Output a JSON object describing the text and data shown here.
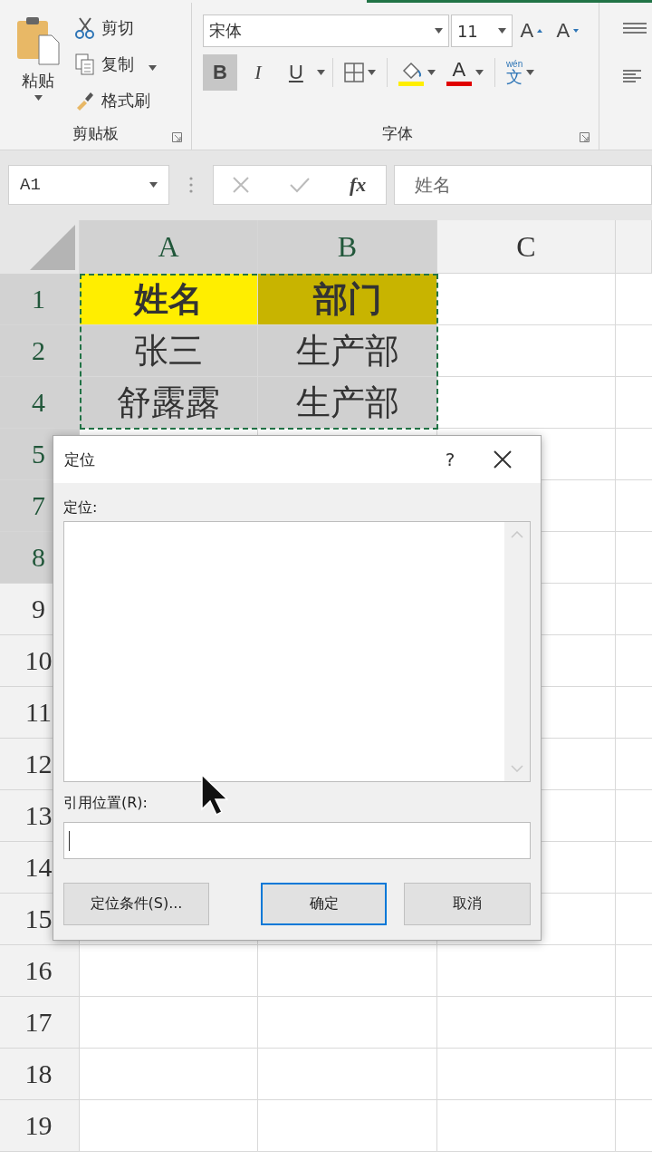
{
  "ribbon": {
    "clipboard": {
      "paste": "粘贴",
      "cut": "剪切",
      "copy": "复制",
      "format_painter": "格式刷",
      "label": "剪贴板"
    },
    "font": {
      "font_name": "宋体",
      "font_size": "11",
      "grow": "A",
      "shrink": "A",
      "bold": {
        "label": "B",
        "on": true
      },
      "italic": {
        "label": "I",
        "on": false
      },
      "underline": {
        "label": "U",
        "on": false
      },
      "font_color": "A",
      "phonetic": {
        "ruby": "wén",
        "glyph": "文"
      },
      "label": "字体"
    }
  },
  "formula_bar": {
    "name_box": "A1",
    "fx": "fx",
    "content": "姓名"
  },
  "sheet": {
    "columns": [
      {
        "label": "A",
        "selected": true
      },
      {
        "label": "B",
        "selected": true
      },
      {
        "label": "C",
        "selected": false
      }
    ],
    "rows": [
      {
        "label": "1",
        "selected": true,
        "cells": [
          {
            "text": "姓名",
            "color": "#ffee00"
          },
          {
            "text": "部门",
            "color": "#c8b400"
          }
        ]
      },
      {
        "label": "2",
        "selected": true,
        "cells": [
          {
            "text": "张三",
            "color": "#d0d0d0"
          },
          {
            "text": "生产部",
            "color": "#d0d0d0"
          }
        ]
      },
      {
        "label": "4",
        "selected": true,
        "cells": [
          {
            "text": "舒露露",
            "color": "#d0d0d0"
          },
          {
            "text": "生产部",
            "color": "#d0d0d0"
          }
        ]
      },
      {
        "label": "5",
        "selected": true,
        "cells": []
      },
      {
        "label": "7",
        "selected": true,
        "cells": []
      },
      {
        "label": "8",
        "selected": true,
        "cells": []
      },
      {
        "label": "9",
        "selected": false,
        "cells": []
      },
      {
        "label": "10",
        "selected": false,
        "cells": []
      },
      {
        "label": "11",
        "selected": false,
        "cells": []
      },
      {
        "label": "12",
        "selected": false,
        "cells": []
      },
      {
        "label": "13",
        "selected": false,
        "cells": []
      },
      {
        "label": "14",
        "selected": false,
        "cells": []
      },
      {
        "label": "15",
        "selected": false,
        "cells": []
      },
      {
        "label": "16",
        "selected": false,
        "cells": []
      },
      {
        "label": "17",
        "selected": false,
        "cells": []
      },
      {
        "label": "18",
        "selected": false,
        "cells": []
      },
      {
        "label": "19",
        "selected": false,
        "cells": []
      }
    ]
  },
  "dialog": {
    "title": "定位",
    "help": "?",
    "list_label": "定位:",
    "ref_label": "引用位置(R):",
    "buttons": [
      {
        "label": "定位条件(S)...",
        "default": false
      },
      {
        "label": "确定",
        "default": true
      },
      {
        "label": "取消",
        "default": false
      }
    ]
  }
}
